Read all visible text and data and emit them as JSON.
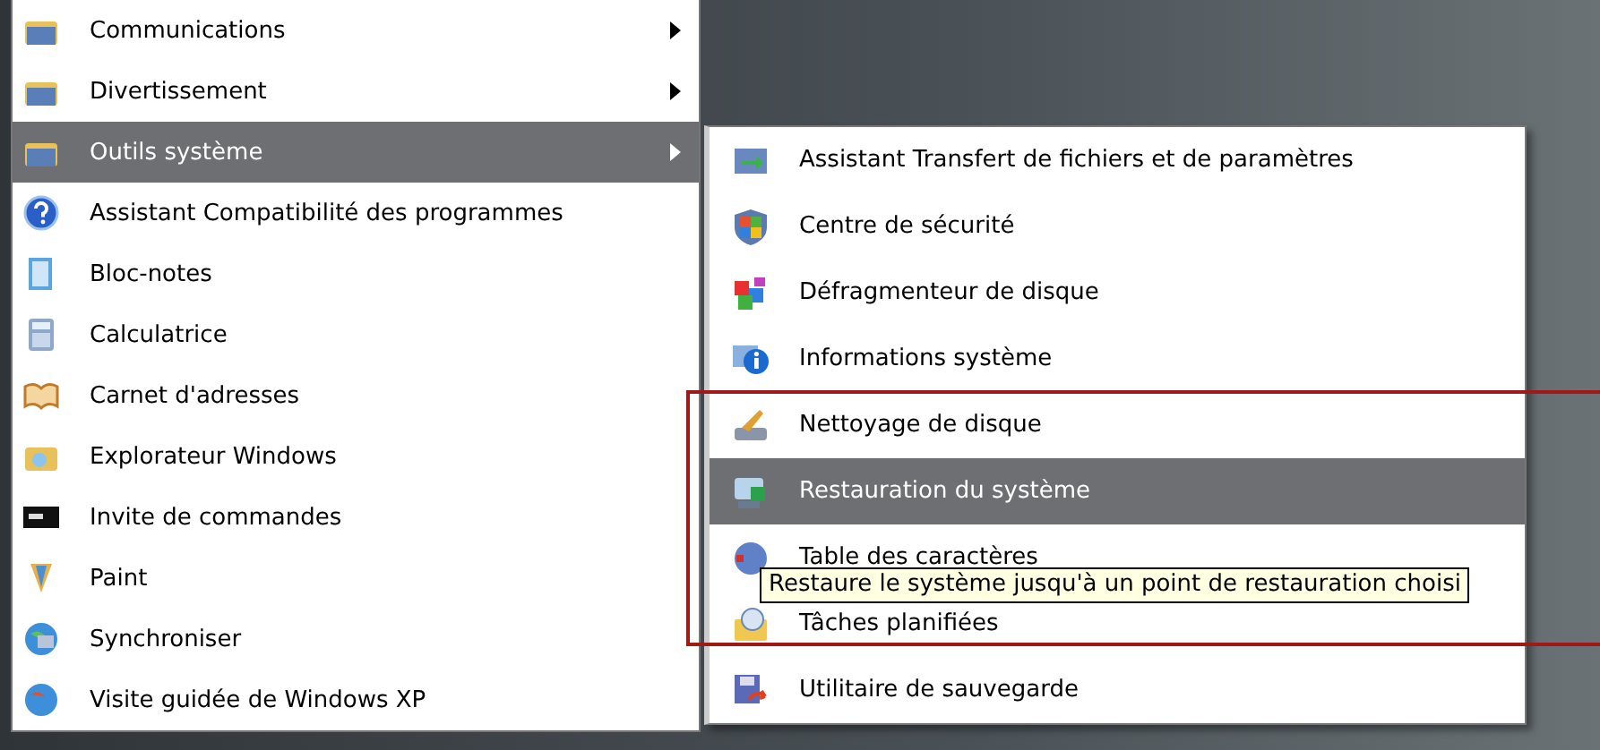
{
  "programs_menu": {
    "items": [
      {
        "label": "Communications",
        "has_submenu": true,
        "selected": false
      },
      {
        "label": "Divertissement",
        "has_submenu": true,
        "selected": false
      },
      {
        "label": "Outils système",
        "has_submenu": true,
        "selected": true
      },
      {
        "label": "Assistant Compatibilité des programmes",
        "has_submenu": false,
        "selected": false
      },
      {
        "label": "Bloc-notes",
        "has_submenu": false,
        "selected": false
      },
      {
        "label": "Calculatrice",
        "has_submenu": false,
        "selected": false
      },
      {
        "label": "Carnet d'adresses",
        "has_submenu": false,
        "selected": false
      },
      {
        "label": "Explorateur Windows",
        "has_submenu": false,
        "selected": false
      },
      {
        "label": "Invite de commandes",
        "has_submenu": false,
        "selected": false
      },
      {
        "label": "Paint",
        "has_submenu": false,
        "selected": false
      },
      {
        "label": "Synchroniser",
        "has_submenu": false,
        "selected": false
      },
      {
        "label": "Visite guidée de Windows XP",
        "has_submenu": false,
        "selected": false
      }
    ]
  },
  "system_tools_menu": {
    "items": [
      {
        "label": "Assistant Transfert de fichiers et de paramètres",
        "selected": false
      },
      {
        "label": "Centre de sécurité",
        "selected": false
      },
      {
        "label": "Défragmenteur de disque",
        "selected": false
      },
      {
        "label": "Informations système",
        "selected": false
      },
      {
        "label": "Nettoyage de disque",
        "selected": false
      },
      {
        "label": "Restauration du système",
        "selected": true
      },
      {
        "label": "Table des caractères",
        "selected": false
      },
      {
        "label": "Tâches planifiées",
        "selected": false
      },
      {
        "label": "Utilitaire de sauvegarde",
        "selected": false
      }
    ]
  },
  "tooltip": {
    "text": "Restaure le système jusqu'à un point de restauration choisi"
  }
}
